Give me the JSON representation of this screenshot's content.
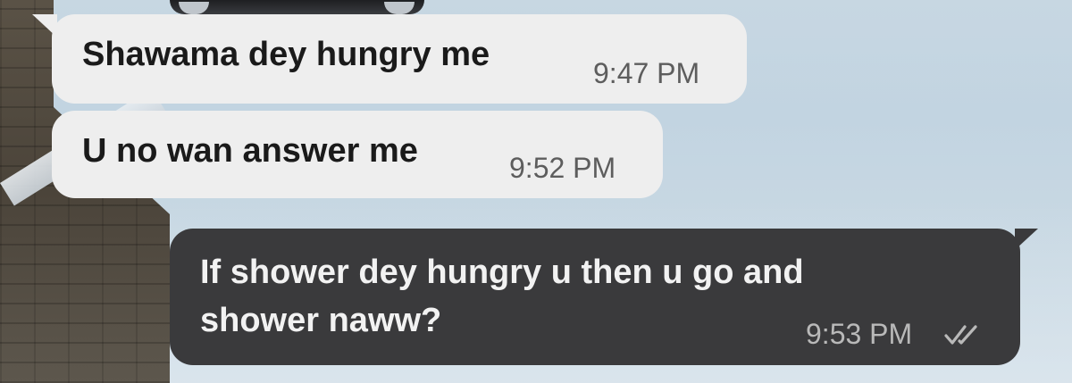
{
  "messages": [
    {
      "direction": "incoming",
      "text": "Shawama dey hungry me",
      "time": "9:47 PM"
    },
    {
      "direction": "incoming",
      "text": "U no wan answer me",
      "time": "9:52 PM"
    },
    {
      "direction": "outgoing",
      "text_line1": "If shower dey hungry u then u go and",
      "text_line2": "shower naww?",
      "time": "9:53 PM",
      "status_icon": "double-check-icon"
    }
  ],
  "colors": {
    "incoming_bubble": "#eeeeee",
    "outgoing_bubble": "#3a3a3c",
    "incoming_text": "#1a1a1a",
    "outgoing_text": "#f2f2f2"
  }
}
